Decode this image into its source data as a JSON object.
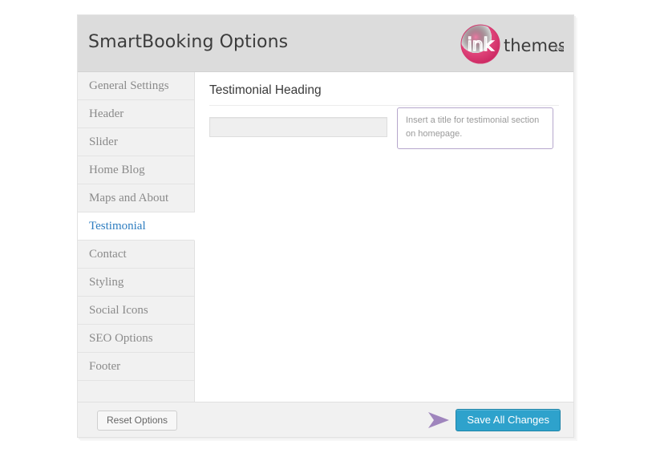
{
  "header": {
    "title": "SmartBooking Options",
    "logo": {
      "mark_text": "ink",
      "word_text": "themes",
      "suffix_text": ".com",
      "circle_color": "#e0457b",
      "word_color": "#3b3b3b"
    }
  },
  "sidebar": {
    "items": [
      {
        "label": "General Settings",
        "active": false
      },
      {
        "label": "Header",
        "active": false
      },
      {
        "label": "Slider",
        "active": false
      },
      {
        "label": "Home Blog",
        "active": false
      },
      {
        "label": "Maps and About",
        "active": false
      },
      {
        "label": "Testimonial",
        "active": true
      },
      {
        "label": "Contact",
        "active": false
      },
      {
        "label": "Styling",
        "active": false
      },
      {
        "label": "Social Icons",
        "active": false
      },
      {
        "label": "SEO Options",
        "active": false
      },
      {
        "label": "Footer",
        "active": false
      }
    ],
    "active_color": "#2e7dc0"
  },
  "content": {
    "section_title": "Testimonial Heading",
    "field": {
      "value": "",
      "placeholder": ""
    },
    "hint": "Insert a title for testimonial section on homepage.",
    "hint_border_color": "#b6a7cc"
  },
  "footer": {
    "reset_label": "Reset Options",
    "save_label": "Save All Changes",
    "save_color": "#2ea2cc",
    "arrow_color": "#9f85bd"
  }
}
